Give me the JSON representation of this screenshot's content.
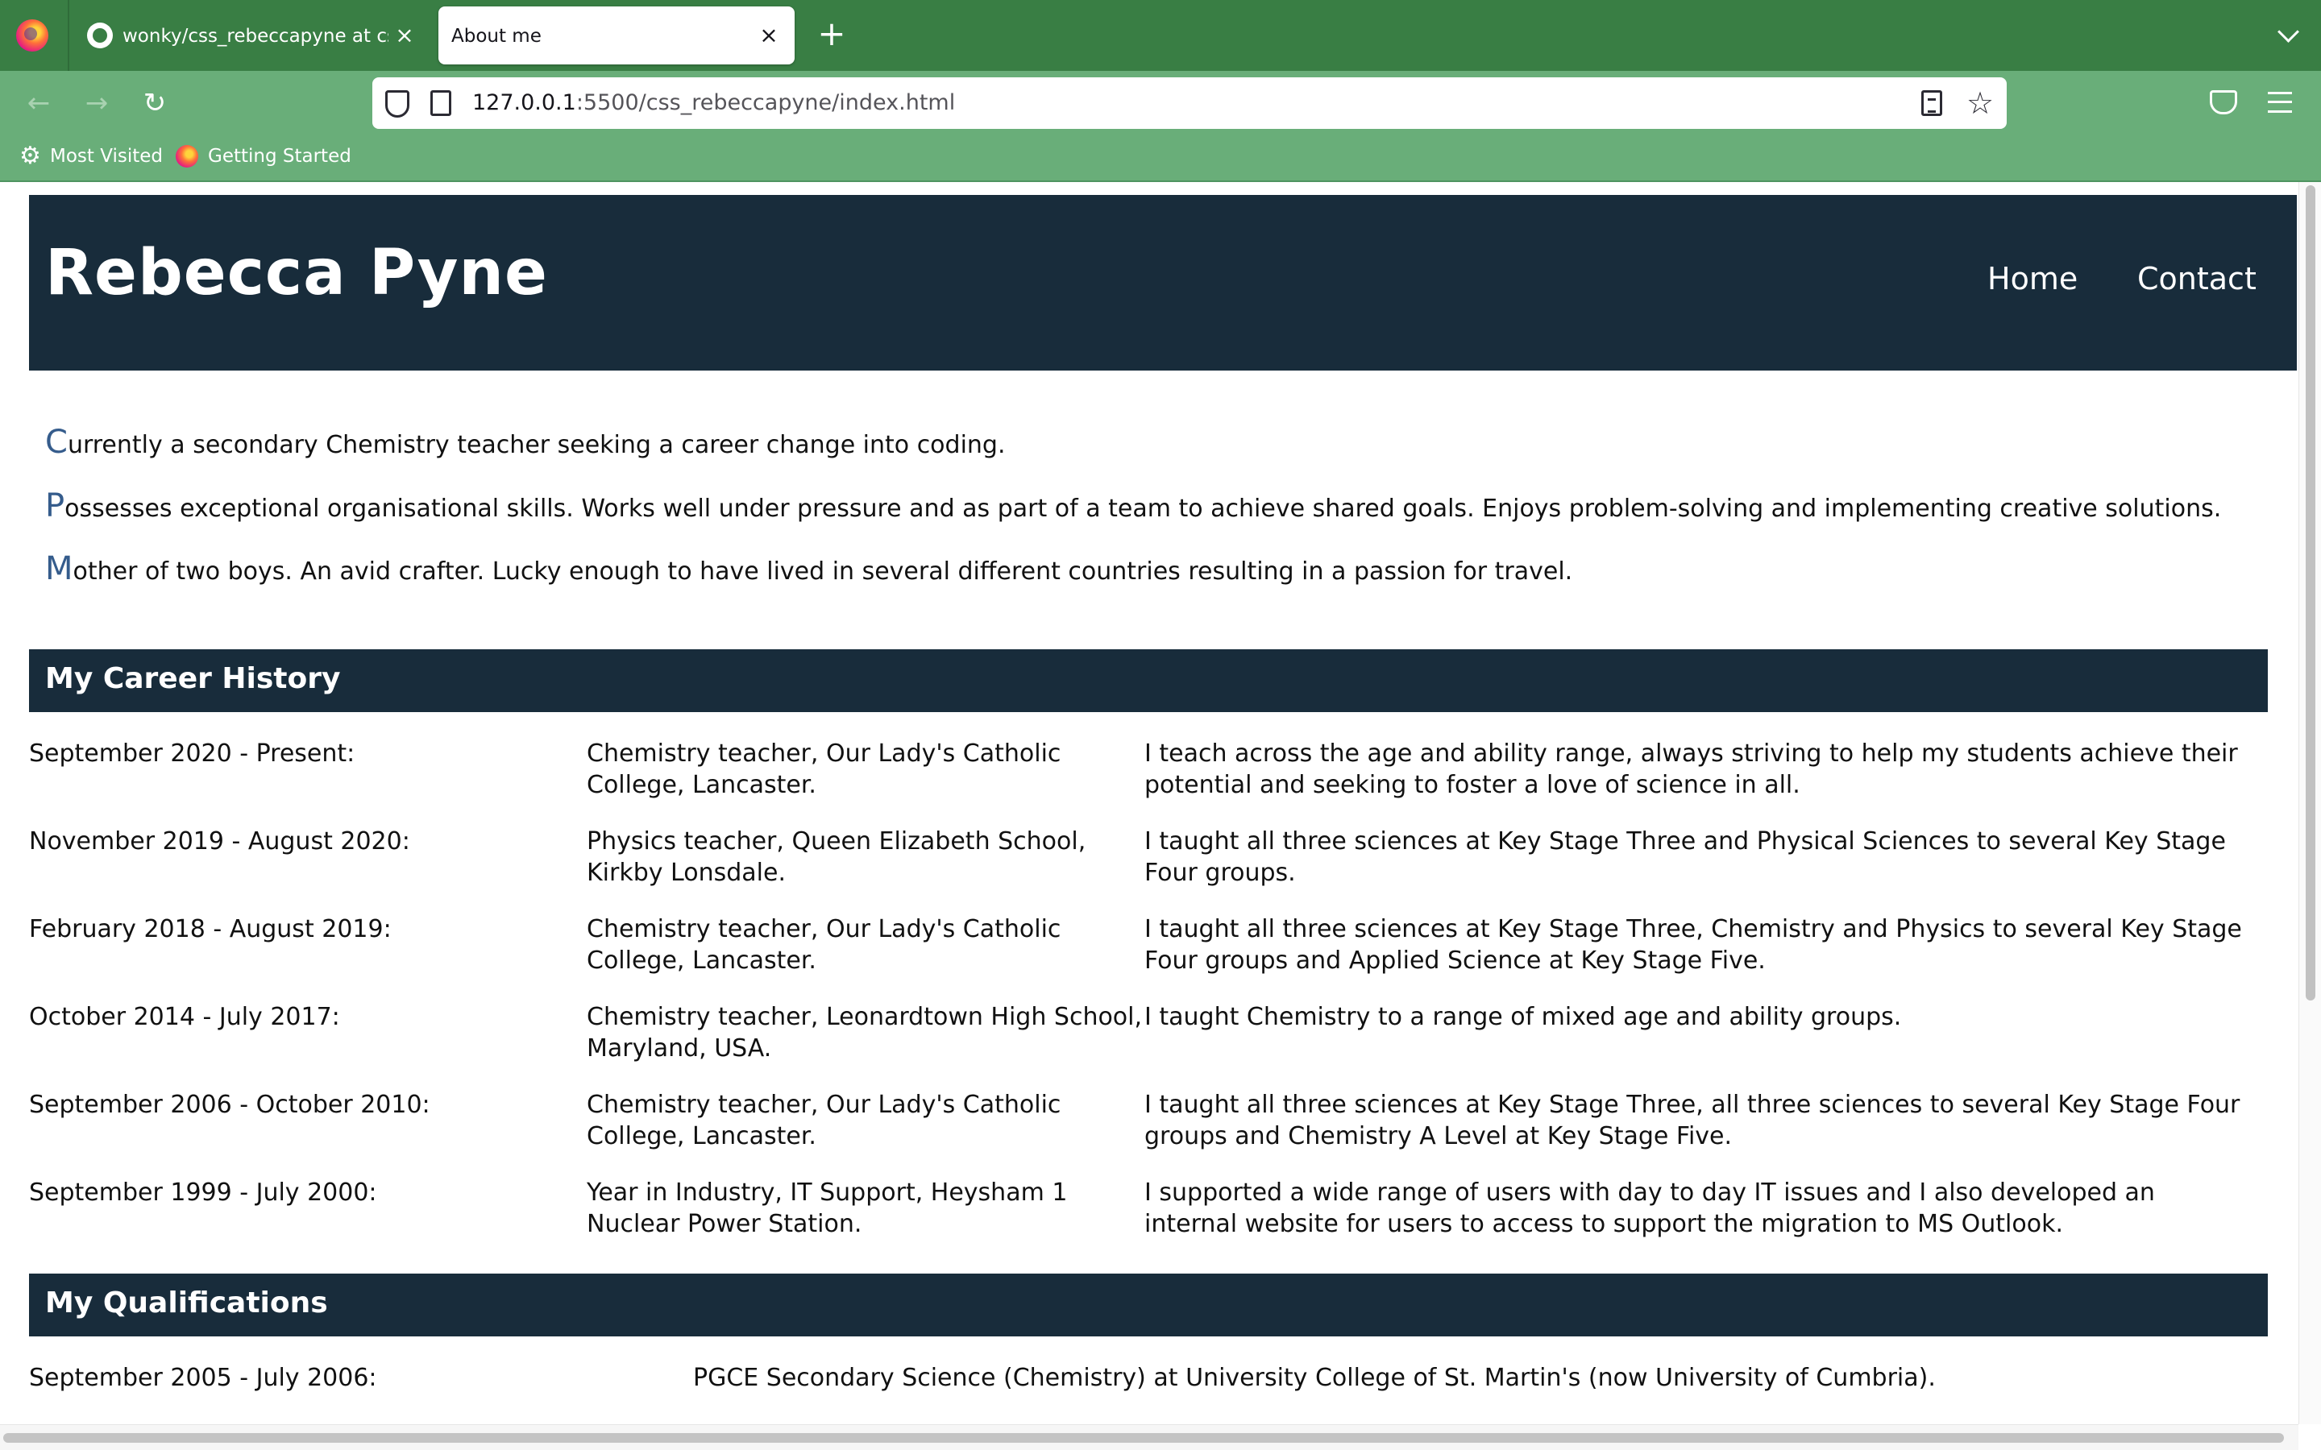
{
  "browser": {
    "tabs": [
      {
        "title": "wonky/css_rebeccapyne at css_",
        "active": false
      },
      {
        "title": "About me",
        "active": true
      }
    ],
    "url": {
      "host": "127.0.0.1",
      "path": ":5500/css_rebeccapyne/index.html"
    },
    "bookmarks": [
      "Most Visited",
      "Getting Started"
    ],
    "colors": {
      "toolbar": "#69ae79",
      "tabstrip": "#397e44"
    }
  },
  "site": {
    "name": "Rebecca Pyne",
    "nav": [
      "Home",
      "Contact"
    ],
    "colors": {
      "header_bg": "#182c3b",
      "dropcap": "#355c8c"
    }
  },
  "intro": [
    {
      "first": "C",
      "rest": "urrently a secondary Chemistry teacher seeking a career change into coding."
    },
    {
      "first": "P",
      "rest": "ossesses exceptional organisational skills. Works well under pressure and as part of a team to achieve shared goals. Enjoys problem-solving and implementing creative solutions."
    },
    {
      "first": "M",
      "rest": "other of two boys. An avid crafter. Lucky enough to have lived in several different countries resulting in a passion for travel."
    }
  ],
  "career": {
    "heading": "My Career History",
    "rows": [
      {
        "date": "September 2020 - Present:",
        "role": [
          "Chemistry teacher, Our Lady's Catholic",
          "College, Lancaster."
        ],
        "desc": [
          "I teach across the age and ability range, always striving to help my students achieve their",
          "potential and seeking to foster a love of science in all."
        ]
      },
      {
        "date": "November 2019 - August 2020:",
        "role": [
          "Physics teacher, Queen Elizabeth School,",
          "Kirkby Lonsdale."
        ],
        "desc": [
          "I taught all three sciences at Key Stage Three and Physical Sciences to several Key Stage",
          "Four groups."
        ]
      },
      {
        "date": "February 2018 - August 2019:",
        "role": [
          "Chemistry teacher, Our Lady's Catholic",
          "College, Lancaster."
        ],
        "desc": [
          "I taught all three sciences at Key Stage Three, Chemistry and Physics to several Key Stage",
          "Four groups and Applied Science at Key Stage Five."
        ]
      },
      {
        "date": "October 2014 - July 2017:",
        "role": [
          "Chemistry teacher, Leonardtown High School,",
          "Maryland, USA."
        ],
        "desc": [
          "I taught Chemistry to a range of mixed age and ability groups.",
          ""
        ]
      },
      {
        "date": "September 2006 - October 2010:",
        "role": [
          "Chemistry teacher, Our Lady's Catholic",
          "College, Lancaster."
        ],
        "desc": [
          "I taught all three sciences at Key Stage Three, all three sciences to several Key Stage Four",
          "groups and Chemistry A Level at Key Stage Five."
        ]
      },
      {
        "date": "September 1999 - July 2000:",
        "role": [
          "Year in Industry, IT Support, Heysham 1",
          "Nuclear Power Station."
        ],
        "desc": [
          "I supported a wide range of users with day to day IT issues and I also developed an",
          "internal website for users to access to support the migration to MS Outlook."
        ]
      }
    ]
  },
  "qualifications": {
    "heading": "My Qualifications",
    "rows": [
      {
        "date": "September 2005 - July 2006:",
        "desc": "PGCE Secondary Science (Chemistry) at University College of St. Martin's (now University of Cumbria)."
      }
    ]
  }
}
